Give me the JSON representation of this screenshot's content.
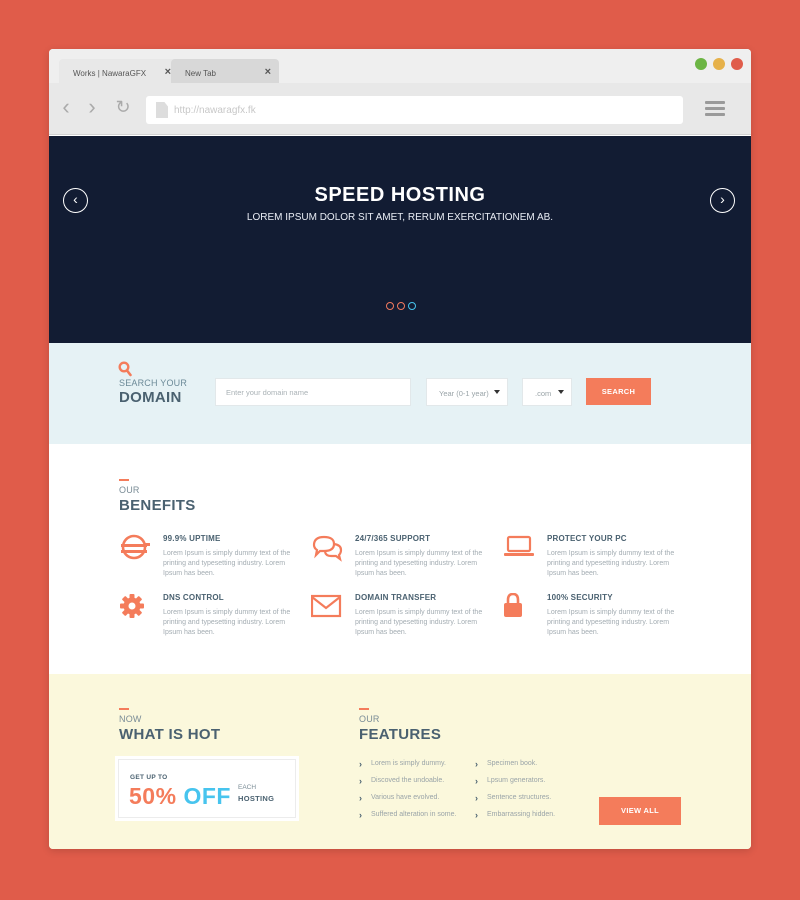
{
  "browser": {
    "tabs": [
      {
        "label": "Works | NawaraGFX",
        "close": "×"
      },
      {
        "label": "New Tab",
        "close": "×"
      }
    ],
    "window_controls": {
      "green": "#6cb544",
      "yellow": "#e6b14a",
      "red": "#e05c4a"
    },
    "url_placeholder": "http://nawaragfx.fk",
    "nav": {
      "back": "‹",
      "forward": "›",
      "reload": "↻"
    }
  },
  "hero": {
    "title": "SPEED HOSTING",
    "subtitle": "LOREM IPSUM DOLOR SIT AMET, RERUM EXERCITATIONEM AB.",
    "prev": "‹",
    "next": "›",
    "active_slide": 3,
    "slide_count": 3
  },
  "domain_search": {
    "small": "SEARCH YOUR",
    "big": "DOMAIN",
    "input_placeholder": "Enter your domain name",
    "year_select": "Year (0-1 year)",
    "tld_select": ".com",
    "button": "SEARCH"
  },
  "benefits": {
    "small": "OUR",
    "big": "BENEFITS",
    "items": [
      {
        "icon": "server-icon",
        "title": "99.9% UPTIME",
        "text": "Lorem Ipsum is simply dummy text of the printing and typesetting industry. Lorem Ipsum has been."
      },
      {
        "icon": "chat-icon",
        "title": "24/7/365 SUPPORT",
        "text": "Lorem Ipsum is simply dummy text of the printing and typesetting industry. Lorem Ipsum has been."
      },
      {
        "icon": "laptop-icon",
        "title": "PROTECT YOUR PC",
        "text": "Lorem Ipsum is simply dummy text of the printing and typesetting industry. Lorem Ipsum has been."
      },
      {
        "icon": "gear-icon",
        "title": "DNS CONTROL",
        "text": "Lorem Ipsum is simply dummy text of the printing and typesetting industry. Lorem Ipsum has been."
      },
      {
        "icon": "envelope-icon",
        "title": "DOMAIN TRANSFER",
        "text": "Lorem Ipsum is simply dummy text of the printing and typesetting industry. Lorem Ipsum has been."
      },
      {
        "icon": "lock-icon",
        "title": "100% SECURITY",
        "text": "Lorem Ipsum is simply dummy text of the printing and typesetting industry. Lorem Ipsum has been."
      }
    ]
  },
  "hot": {
    "small": "NOW",
    "big": "WHAT IS HOT",
    "promo_get": "GET UP TO",
    "promo_pct": "50%",
    "promo_off": "OFF",
    "promo_each": "EACH",
    "promo_hosting": "HOSTING"
  },
  "features": {
    "small": "OUR",
    "big": "FEATURES",
    "col1": [
      "Lorem is simply dummy.",
      "Discoved the undoable.",
      "Various have evolved.",
      "Suffered alteration in some."
    ],
    "col2": [
      "Specimen book.",
      "Lpsum generators.",
      "Sentence structures.",
      "Embarrassing hidden."
    ],
    "button": "VIEW ALL"
  },
  "colors": {
    "accent": "#f47c5b",
    "hero_bg": "#121c33",
    "blue": "#47c4ee",
    "heading": "#4a6170"
  }
}
